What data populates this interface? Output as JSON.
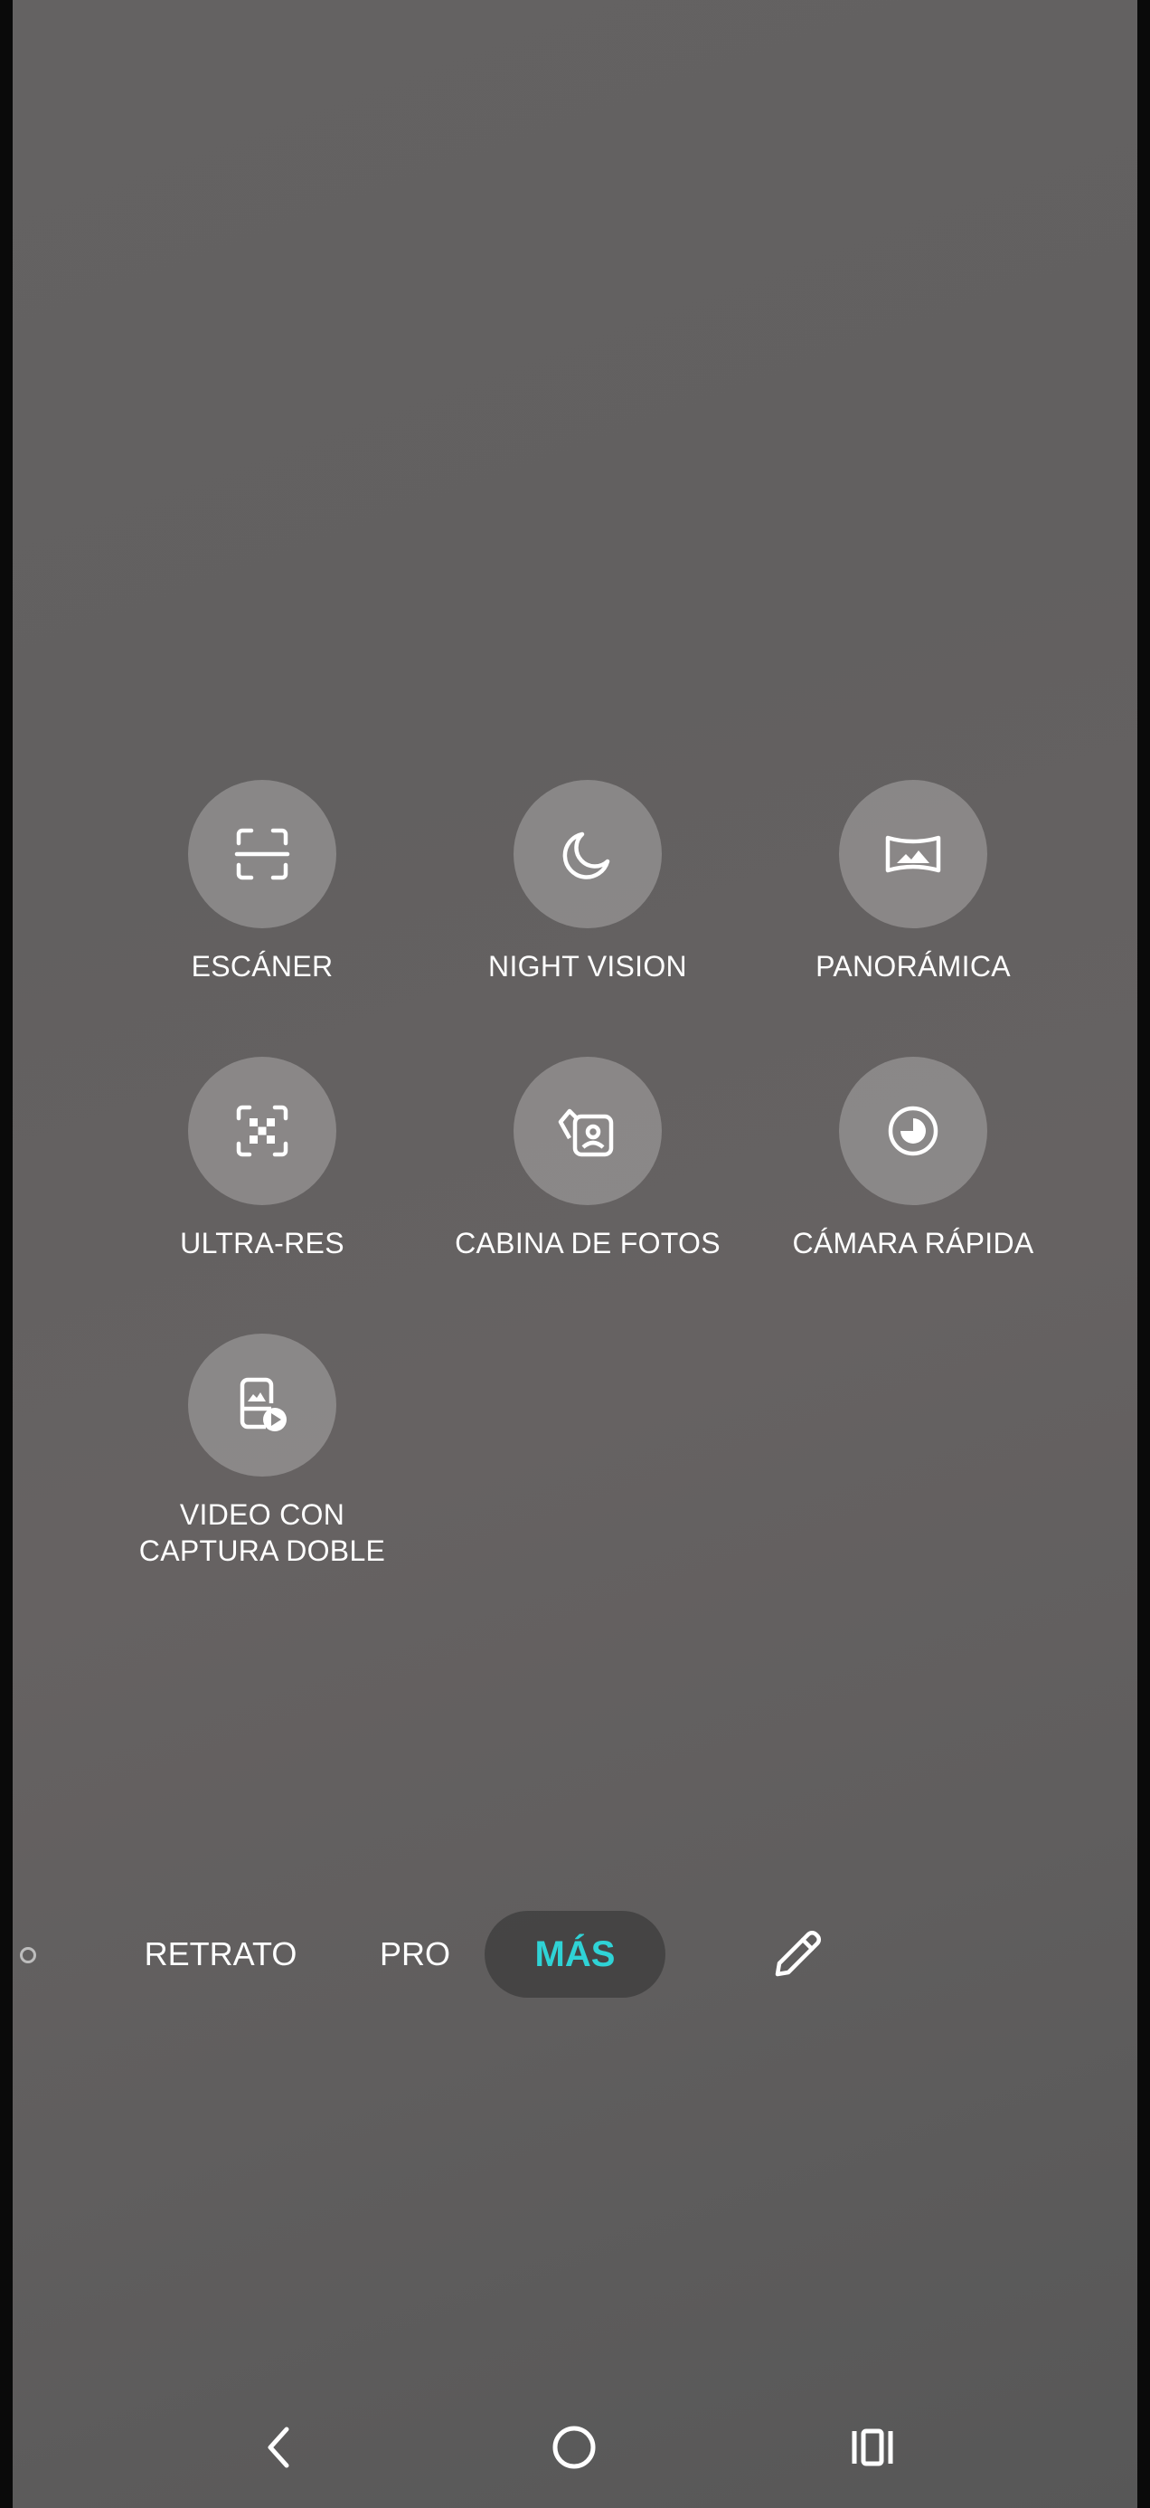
{
  "modes": [
    {
      "id": "scanner",
      "label": "ESCÁNER",
      "icon": "scanner-icon"
    },
    {
      "id": "night-vision",
      "label": "NIGHT VISION",
      "icon": "moon-icon"
    },
    {
      "id": "panoramic",
      "label": "PANORÁMICA",
      "icon": "panorama-icon"
    },
    {
      "id": "ultra-res",
      "label": "ULTRA-RES",
      "icon": "ultra-res-icon"
    },
    {
      "id": "photo-booth",
      "label": "CABINA DE FOTOS",
      "icon": "photo-booth-icon"
    },
    {
      "id": "fast-camera",
      "label": "CÁMARA RÁPIDA",
      "icon": "timelapse-icon"
    },
    {
      "id": "dual-capture",
      "label": "VIDEO CON CAPTURA DOBLE",
      "icon": "dual-capture-icon"
    }
  ],
  "mode_bar": {
    "tabs": [
      "RETRATO",
      "PRO",
      "MÁS"
    ],
    "active": "MÁS"
  },
  "colors": {
    "accent": "#2fd3d6",
    "text": "#ffffff"
  },
  "navbar": {
    "icons": [
      "back-icon",
      "home-icon",
      "recents-icon"
    ]
  }
}
